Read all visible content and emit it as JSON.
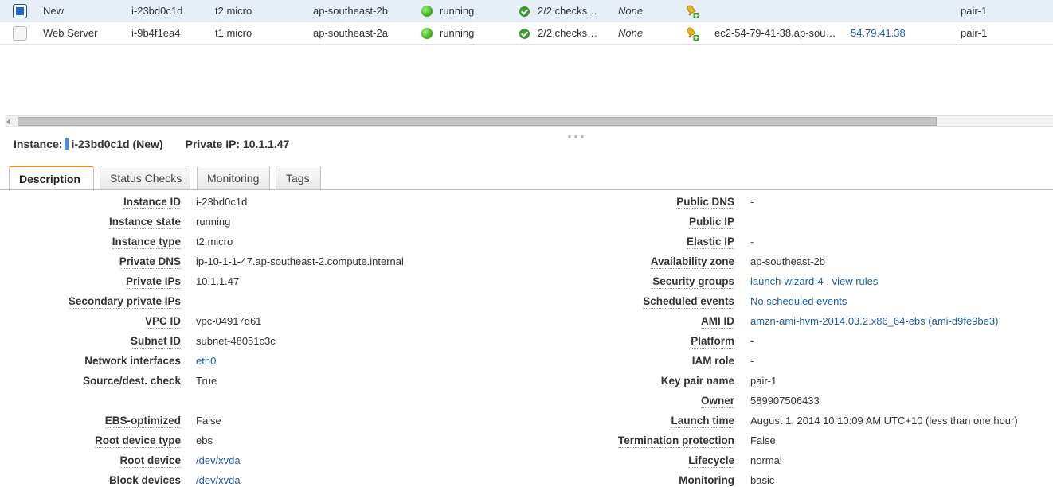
{
  "instances": [
    {
      "selected": true,
      "name": "New",
      "instance_id": "i-23bd0c1d",
      "type": "t2.micro",
      "az": "ap-southeast-2b",
      "state": "running",
      "status_checks": "2/2 checks…",
      "alarm_status": "None",
      "public_dns": "",
      "public_ip": "",
      "key_name": "pair-1"
    },
    {
      "selected": false,
      "name": "Web Server",
      "instance_id": "i-9b4f1ea4",
      "type": "t1.micro",
      "az": "ap-southeast-2a",
      "state": "running",
      "status_checks": "2/2 checks…",
      "alarm_status": "None",
      "public_dns": "ec2-54-79-41-38.ap-sou…",
      "public_ip": "54.79.41.38",
      "key_name": "pair-1"
    }
  ],
  "header": {
    "instance_label": "Instance:",
    "instance_value": "i-23bd0c1d (New)",
    "private_ip_label": "Private IP:",
    "private_ip_value": "10.1.1.47"
  },
  "tabs": [
    {
      "label": "Description",
      "active": true
    },
    {
      "label": "Status Checks",
      "active": false
    },
    {
      "label": "Monitoring",
      "active": false
    },
    {
      "label": "Tags",
      "active": false
    }
  ],
  "description_left": [
    {
      "label": "Instance ID",
      "value": "i-23bd0c1d"
    },
    {
      "label": "Instance state",
      "value": "running"
    },
    {
      "label": "Instance type",
      "value": "t2.micro"
    },
    {
      "label": "Private DNS",
      "value": "ip-10-1-1-47.ap-southeast-2.compute.internal"
    },
    {
      "label": "Private IPs",
      "value": "10.1.1.47"
    },
    {
      "label": "Secondary private IPs",
      "value": ""
    },
    {
      "label": "VPC ID",
      "value": "vpc-04917d61"
    },
    {
      "label": "Subnet ID",
      "value": "subnet-48051c3c"
    },
    {
      "label": "Network interfaces",
      "value": "eth0",
      "link": true
    },
    {
      "label": "Source/dest. check",
      "value": "True"
    },
    {
      "label": "",
      "value": ""
    },
    {
      "label": "EBS-optimized",
      "value": "False"
    },
    {
      "label": "Root device type",
      "value": "ebs"
    },
    {
      "label": "Root device",
      "value": "/dev/xvda",
      "link": true
    },
    {
      "label": "Block devices",
      "value": "/dev/xvda",
      "link": true
    }
  ],
  "description_right": [
    {
      "label": "Public DNS",
      "value": "-"
    },
    {
      "label": "Public IP",
      "value": ""
    },
    {
      "label": "Elastic IP",
      "value": "-",
      "link": true
    },
    {
      "label": "Availability zone",
      "value": "ap-southeast-2b"
    },
    {
      "label": "Security groups",
      "value": "launch-wizard-4 .  view rules",
      "link": true
    },
    {
      "label": "Scheduled events",
      "value": "No scheduled events",
      "link": true
    },
    {
      "label": "AMI ID",
      "value": "amzn-ami-hvm-2014.03.2.x86_64-ebs (ami-d9fe9be3)",
      "link": true
    },
    {
      "label": "Platform",
      "value": "-"
    },
    {
      "label": "IAM role",
      "value": "-"
    },
    {
      "label": "Key pair name",
      "value": "pair-1"
    },
    {
      "label": "Owner",
      "value": "589907506433"
    },
    {
      "label": "Launch time",
      "value": "August 1, 2014 10:10:09 AM UTC+10 (less than one hour)"
    },
    {
      "label": "Termination protection",
      "value": "False"
    },
    {
      "label": "Lifecycle",
      "value": "normal"
    },
    {
      "label": "Monitoring",
      "value": "basic"
    }
  ],
  "icons": {
    "running": "green-dot-icon",
    "status_ok": "green-check-icon",
    "alarm": "add-alarm-icon"
  },
  "colors": {
    "selected_row": "#e6eef8",
    "link": "#1f5fa5",
    "active_tab_accent": "#e29a2b",
    "running": "#3fb51b"
  }
}
